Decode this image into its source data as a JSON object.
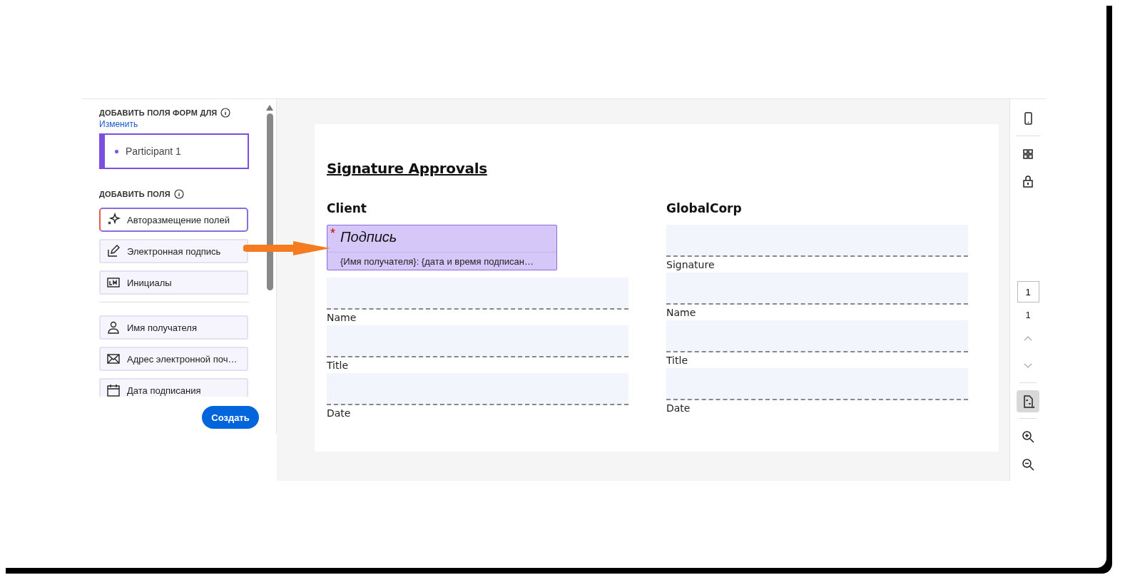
{
  "left_panel": {
    "section_title": "ДОБАВИТЬ ПОЛЯ ФОРМ ДЛЯ",
    "change_link": "Изменить",
    "participants": [
      {
        "name": "Participant 1",
        "selected": true,
        "color": "#7b4fe0"
      }
    ],
    "fields_title": "ДОБАВИТЬ ПОЛЯ",
    "field_groups": [
      [
        {
          "label": "Авторазмещение полей",
          "kind": "auto"
        },
        {
          "label": "Электронная подпись",
          "kind": "signature"
        },
        {
          "label": "Инициалы",
          "kind": "initials"
        }
      ],
      [
        {
          "label": "Имя получателя",
          "kind": "person"
        },
        {
          "label": "Адрес электронной поч…",
          "kind": "email"
        },
        {
          "label": "Дата подписания",
          "kind": "calendar"
        }
      ]
    ],
    "create_button": "Создать"
  },
  "document": {
    "title": "Signature Approvals",
    "columns": [
      {
        "heading": "Client",
        "placed_field": {
          "label": "Подпись",
          "required_mark": "*",
          "hint": "{Имя получателя}: {дата и время подписан…"
        },
        "lines": [
          "Name",
          "Title",
          "Date"
        ]
      },
      {
        "heading": "GlobalCorp",
        "lines": [
          "Signature",
          "Name",
          "Title",
          "Date"
        ]
      }
    ]
  },
  "right_rail": {
    "page_input": "1",
    "page_count": "1",
    "prev_disabled": true,
    "next_disabled": true,
    "fit_selected": true
  }
}
